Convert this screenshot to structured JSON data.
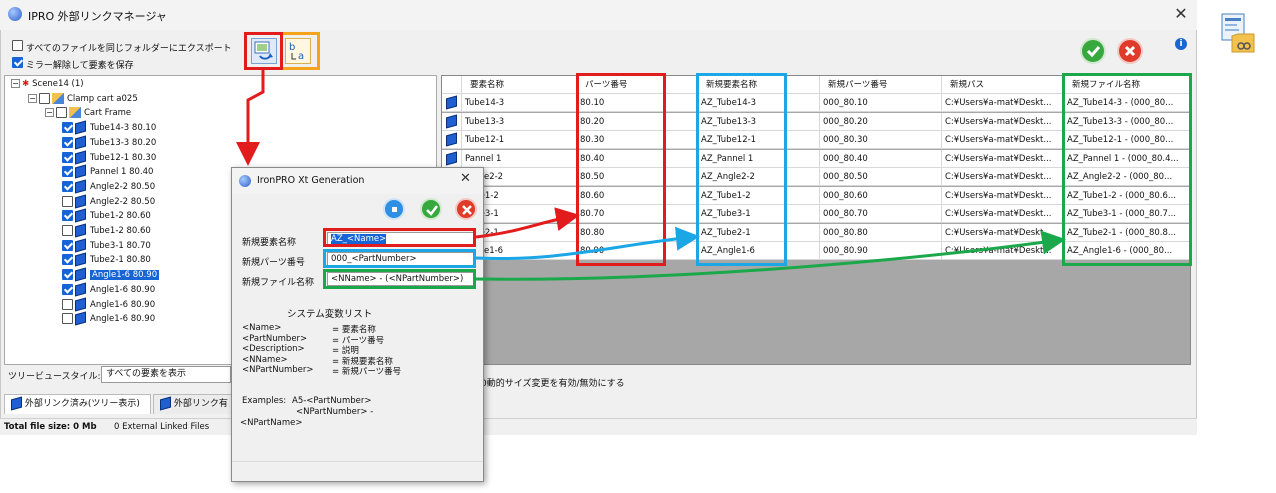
{
  "window": {
    "title": "IPRO 外部リンクマネージャ",
    "close": "✕"
  },
  "options": {
    "export_same_folder": "すべてのファイルを同じフォルダーにエクスポート",
    "export_same_folder_checked": false,
    "keep_mirror": "ミラー解除して要素を保存",
    "keep_mirror_checked": true
  },
  "tree": [
    {
      "label": "Scene14 (1)",
      "level": 0,
      "checkbox": false,
      "kind": "scene"
    },
    {
      "label": "Clamp cart a025",
      "level": 1,
      "checkbox": true,
      "checked": false,
      "kind": "assembly"
    },
    {
      "label": "Cart Frame",
      "level": 2,
      "checkbox": true,
      "checked": false,
      "kind": "assembly"
    },
    {
      "label": "Tube14-3 80.10",
      "level": 3,
      "checkbox": true,
      "checked": true,
      "kind": "part"
    },
    {
      "label": "Tube13-3 80.20",
      "level": 3,
      "checkbox": true,
      "checked": true,
      "kind": "part"
    },
    {
      "label": "Tube12-1 80.30",
      "level": 3,
      "checkbox": true,
      "checked": true,
      "kind": "part"
    },
    {
      "label": "Pannel 1 80.40",
      "level": 3,
      "checkbox": true,
      "checked": true,
      "kind": "part"
    },
    {
      "label": "Angle2-2 80.50",
      "level": 3,
      "checkbox": true,
      "checked": true,
      "kind": "part"
    },
    {
      "label": "Angle2-2 80.50",
      "level": 3,
      "checkbox": true,
      "checked": false,
      "kind": "part"
    },
    {
      "label": "Tube1-2 80.60",
      "level": 3,
      "checkbox": true,
      "checked": true,
      "kind": "part"
    },
    {
      "label": "Tube1-2 80.60",
      "level": 3,
      "checkbox": true,
      "checked": false,
      "kind": "part"
    },
    {
      "label": "Tube3-1 80.70",
      "level": 3,
      "checkbox": true,
      "checked": true,
      "kind": "part"
    },
    {
      "label": "Tube2-1 80.80",
      "level": 3,
      "checkbox": true,
      "checked": true,
      "kind": "part"
    },
    {
      "label": "Angle1-6 80.90",
      "level": 3,
      "checkbox": true,
      "checked": true,
      "kind": "part",
      "selected": true
    },
    {
      "label": "Angle1-6 80.90",
      "level": 3,
      "checkbox": true,
      "checked": true,
      "kind": "part"
    },
    {
      "label": "Angle1-6 80.90",
      "level": 3,
      "checkbox": true,
      "checked": false,
      "kind": "part"
    },
    {
      "label": "Angle1-6 80.90",
      "level": 3,
      "checkbox": true,
      "checked": false,
      "kind": "part"
    }
  ],
  "tree_style": {
    "label": "ツリービュースタイル:",
    "value": "すべての要素を表示"
  },
  "tabs": [
    {
      "label": "外部リンク済み(ツリー表示)"
    },
    {
      "label": "外部リンク有"
    }
  ],
  "grid": {
    "headers": [
      "要素名称",
      "パーツ番号",
      "新規要素名称",
      "新規パーツ番号",
      "新規パス",
      "新規ファイル名称"
    ],
    "rows": [
      [
        "Tube14-3",
        "80.10",
        "AZ_Tube14-3",
        "000_80.10",
        "C:¥Users¥a-mat¥Deskt...",
        "AZ_Tube14-3 - (000_80..."
      ],
      [
        "Tube13-3",
        "80.20",
        "AZ_Tube13-3",
        "000_80.20",
        "C:¥Users¥a-mat¥Deskt...",
        "AZ_Tube13-3 - (000_80..."
      ],
      [
        "Tube12-1",
        "80.30",
        "AZ_Tube12-1",
        "000_80.30",
        "C:¥Users¥a-mat¥Deskt...",
        "AZ_Tube12-1 - (000_80..."
      ],
      [
        "Pannel 1",
        "80.40",
        "AZ_Pannel 1",
        "000_80.40",
        "C:¥Users¥a-mat¥Deskt...",
        "AZ_Pannel 1 - (000_80.4..."
      ],
      [
        "Angle2-2",
        "80.50",
        "AZ_Angle2-2",
        "000_80.50",
        "C:¥Users¥a-mat¥Deskt...",
        "AZ_Angle2-2 - (000_80..."
      ],
      [
        "Tube1-2",
        "80.60",
        "AZ_Tube1-2",
        "000_80.60",
        "C:¥Users¥a-mat¥Deskt...",
        "AZ_Tube1-2 - (000_80.6..."
      ],
      [
        "Tube3-1",
        "80.70",
        "AZ_Tube3-1",
        "000_80.70",
        "C:¥Users¥a-mat¥Deskt...",
        "AZ_Tube3-1 - (000_80.7..."
      ],
      [
        "Tube2-1",
        "80.80",
        "AZ_Tube2-1",
        "000_80.80",
        "C:¥Users¥a-mat¥Deskt...",
        "AZ_Tube2-1 - (000_80.8..."
      ],
      [
        "Angle1-6",
        "80.90",
        "AZ_Angle1-6",
        "000_80.90",
        "C:¥Users¥a-mat¥Deskt...",
        "AZ_Angle1-6 - (000_80..."
      ]
    ]
  },
  "auto_resize": "0動的サイズ変更を有効/無効にする",
  "status": {
    "total": "Total file size: 0 Mb",
    "links": "0 External Linked Files"
  },
  "dialog": {
    "title": "IronPRO Xt Generation",
    "close": "✕",
    "fields": [
      {
        "label": "新規要素名称",
        "value": "AZ_<Name>"
      },
      {
        "label": "新規パーツ番号",
        "value": "000_<PartNumber>"
      },
      {
        "label": "新規ファイル名称",
        "value": "<NName> - (<NPartNumber>)"
      }
    ],
    "sysvar_title": "システム変数リスト",
    "sysvars": [
      {
        "key": "<Name>",
        "desc": "= 要素名称"
      },
      {
        "key": "<PartNumber>",
        "desc": "= パーツ番号"
      },
      {
        "key": "<Description>",
        "desc": "= 説明"
      },
      {
        "key": "<NName>",
        "desc": "= 新規要素名称"
      },
      {
        "key": "<NPartNumber>",
        "desc": "= 新規パーツ番号"
      }
    ],
    "examples_label": "Examples:",
    "examples_value": "A5-<PartNumber>",
    "examples_line2": "<NPartNumber> -",
    "examples_line3": "<NPartName>"
  },
  "colors": {
    "red": "#e21c1c",
    "blue": "#1ba6e6",
    "green": "#1aa84a",
    "orange": "#f5a31b",
    "selected": "#1764d6"
  }
}
